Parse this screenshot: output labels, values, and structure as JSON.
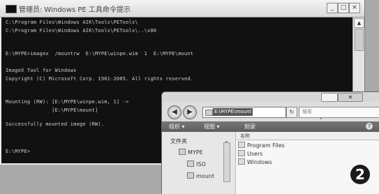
{
  "console": {
    "title": "管理员: Windows PE 工具命令提示",
    "controls": {
      "minimize": "_",
      "restore": "□",
      "close": "×"
    },
    "lines": [
      "C:\\Program Files\\Windows AIK\\Tools\\PETools\\",
      "C:\\Program Files\\Windows AIK\\Tools\\PETools\\..\\x86",
      "",
      "E:\\MYPE>imagex  /mountrw  E:\\MYPE\\winpe.wim  1  E:\\MYPE\\mount",
      "",
      "ImageX Tool for Windows",
      "Copyright (C) Microsoft Corp. 1981-2005. All rights reserved.",
      "",
      "",
      "Mounting (RW): [E:\\MYPE\\winpe.wim, 1] ->",
      "               [E:\\MYPE\\mount]",
      "",
      "Successfully mounted image (RW).",
      "",
      "",
      "",
      "E:\\MYPE>"
    ]
  },
  "explorer": {
    "address": "E:\\MYPE\\mount",
    "search_placeholder": "搜索",
    "toolbar": {
      "organize": "组织 ▾",
      "views": "视图 ▾",
      "burn": "刻录"
    },
    "nav": {
      "header": "文件夹",
      "items": [
        "MYPE",
        "ISO",
        "mount"
      ]
    },
    "content": {
      "column": "名称",
      "items": [
        "Program Files",
        "Users",
        "Windows"
      ]
    }
  },
  "step_number": "2"
}
